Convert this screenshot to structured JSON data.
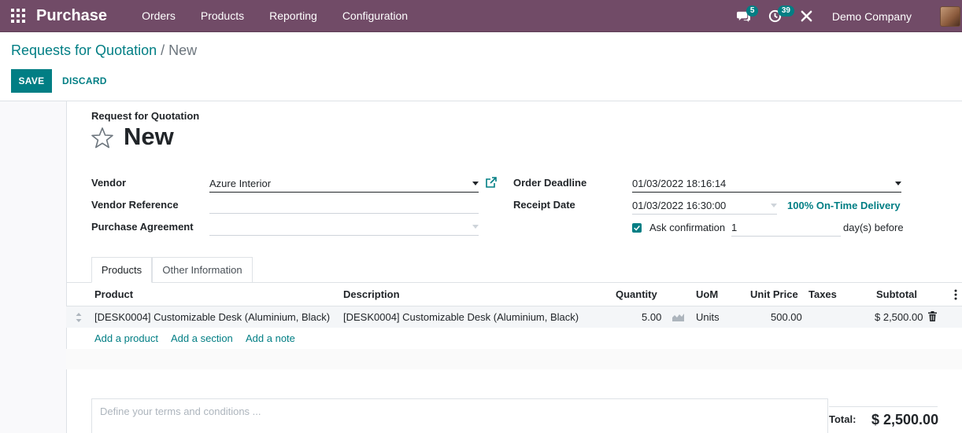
{
  "navbar": {
    "app_name": "Purchase",
    "menu": [
      "Orders",
      "Products",
      "Reporting",
      "Configuration"
    ],
    "messages_count": "5",
    "activities_count": "39",
    "company": "Demo Company",
    "color": "#714b67"
  },
  "control_panel": {
    "breadcrumb_parent": "Requests for Quotation",
    "breadcrumb_sep": "/",
    "breadcrumb_current": "New",
    "save_label": "SAVE",
    "discard_label": "DISCARD"
  },
  "form": {
    "subtitle": "Request for Quotation",
    "title": "New",
    "fields": {
      "vendor_label": "Vendor",
      "vendor_value": "Azure Interior",
      "vendor_ref_label": "Vendor Reference",
      "vendor_ref_value": "",
      "agreement_label": "Purchase Agreement",
      "agreement_value": "",
      "order_deadline_label": "Order Deadline",
      "order_deadline_value": "01/03/2022 18:16:14",
      "receipt_date_label": "Receipt Date",
      "receipt_date_value": "01/03/2022 16:30:00",
      "on_time_delivery": "100% On-Time Delivery",
      "ask_confirmation_label": "Ask confirmation",
      "ask_confirmation_checked": true,
      "ask_confirmation_days": "1",
      "days_before_label": "day(s) before"
    }
  },
  "tabs": [
    {
      "label": "Products",
      "active": true
    },
    {
      "label": "Other Information",
      "active": false
    }
  ],
  "order_lines": {
    "columns": [
      "Product",
      "Description",
      "Quantity",
      "UoM",
      "Unit Price",
      "Taxes",
      "Subtotal"
    ],
    "rows": [
      {
        "product": "[DESK0004] Customizable Desk (Aluminium, Black)",
        "description": "[DESK0004] Customizable Desk (Aluminium, Black)",
        "quantity": "5.00",
        "uom": "Units",
        "unit_price": "500.00",
        "taxes": "",
        "subtotal": "$ 2,500.00"
      }
    ],
    "add_product": "Add a product",
    "add_section": "Add a section",
    "add_note": "Add a note"
  },
  "notes": {
    "placeholder": "Define your terms and conditions ..."
  },
  "totals": {
    "total_label": "Total:",
    "total_value": "$ 2,500.00"
  },
  "colors": {
    "primary": "#017e84",
    "brand": "#714b67"
  }
}
